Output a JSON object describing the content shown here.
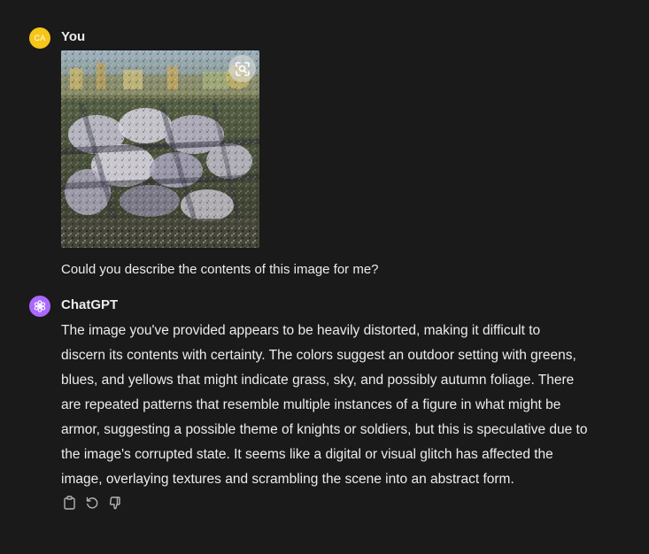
{
  "colors": {
    "background": "#1a1a1a",
    "text": "#ececec",
    "user_avatar": "#f5c518",
    "bot_avatar": "#ab68ff",
    "icon": "#b4b4b4"
  },
  "user_message": {
    "avatar_initials": "CA",
    "author": "You",
    "attachment_icon": "zoom-scan-icon",
    "text": "Could you describe the contents of this image for me?"
  },
  "bot_message": {
    "avatar_icon": "openai-logo-icon",
    "author": "ChatGPT",
    "lines": [
      "The image you've provided appears to be heavily distorted, making it difficult to",
      "discern its contents with certainty. The colors suggest an outdoor setting with greens,",
      "blues, and yellows that might indicate grass, sky, and possibly autumn foliage. There",
      "are repeated patterns that resemble multiple instances of a figure in what might be",
      "armor, suggesting a possible theme of knights or soldiers, but this is speculative due to",
      "the image's corrupted state. It seems like a digital or visual glitch has affected the",
      "image, overlaying textures and scrambling the scene into an abstract form."
    ],
    "actions": [
      "copy-icon",
      "regenerate-icon",
      "thumbs-down-icon"
    ]
  }
}
